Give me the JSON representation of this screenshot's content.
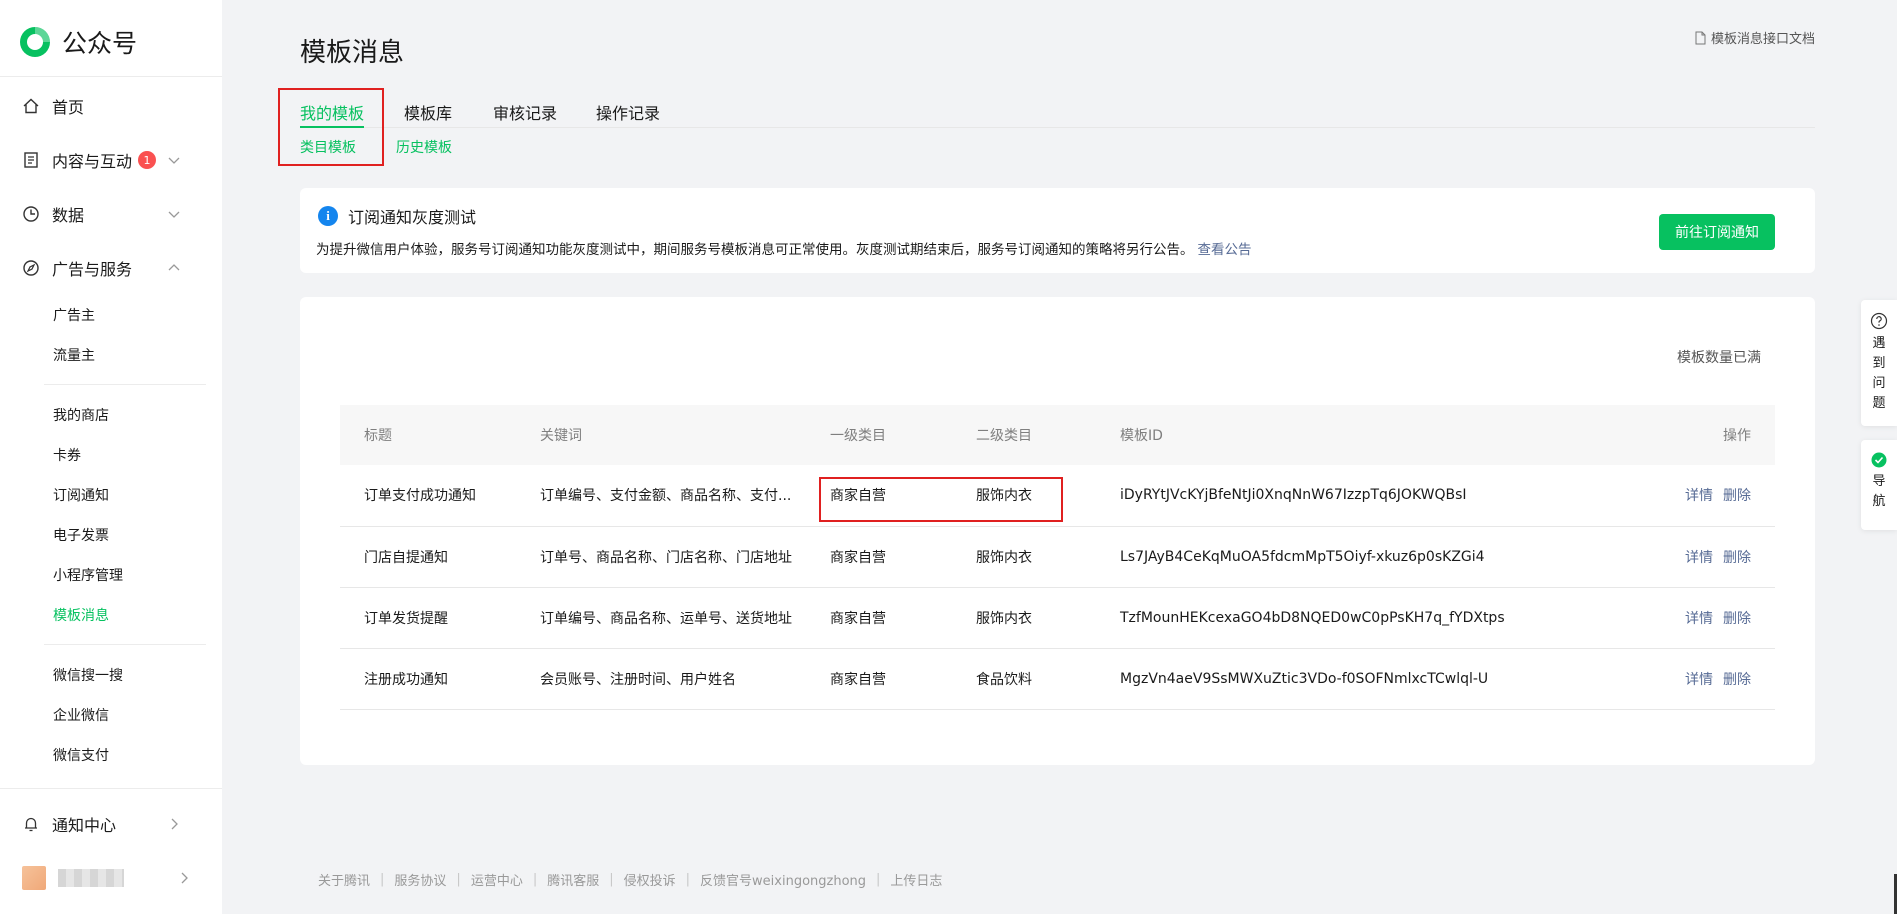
{
  "brand": {
    "name": "公众号",
    "accent": "#07c160"
  },
  "sidebar": {
    "items": [
      {
        "label": "首页",
        "icon": "home-icon"
      },
      {
        "label": "内容与互动",
        "icon": "document-icon",
        "badge": "1"
      },
      {
        "label": "数据",
        "icon": "clock-icon"
      },
      {
        "label": "广告与服务",
        "icon": "compass-icon"
      }
    ],
    "ads_sub": [
      "广告主",
      "流量主"
    ],
    "service_sub": [
      "我的商店",
      "卡券",
      "订阅通知",
      "电子发票",
      "小程序管理",
      "模板消息"
    ],
    "active_sub": "模板消息",
    "extra_sub": [
      "微信搜一搜",
      "企业微信",
      "微信支付"
    ],
    "notification": "通知中心"
  },
  "header": {
    "title": "模板消息",
    "doc_link": "模板消息接口文档"
  },
  "tabs": [
    {
      "label": "我的模板",
      "active": true
    },
    {
      "label": "模板库"
    },
    {
      "label": "审核记录"
    },
    {
      "label": "操作记录"
    }
  ],
  "subtabs": [
    {
      "label": "类目模板",
      "active": true
    },
    {
      "label": "历史模板"
    }
  ],
  "notice": {
    "title": "订阅通知灰度测试",
    "text": "为提升微信用户体验，服务号订阅通知功能灰度测试中，期间服务号模板消息可正常使用。灰度测试期结束后，服务号订阅通知的策略将另行公告。",
    "link": "查看公告",
    "button": "前往订阅通知"
  },
  "table": {
    "quota": "模板数量已满",
    "headers": [
      "标题",
      "关键词",
      "一级类目",
      "二级类目",
      "模板ID",
      "操作"
    ],
    "rows": [
      {
        "title": "订单支付成功通知",
        "keywords": "订单编号、支付金额、商品名称、支付...",
        "cat1": "商家自营",
        "cat2": "服饰内衣",
        "id": "iDyRYtJVcKYjBfeNtJi0XnqNnW67IzzpTq6JOKWQBsI"
      },
      {
        "title": "门店自提通知",
        "keywords": "订单号、商品名称、门店名称、门店地址",
        "cat1": "商家自营",
        "cat2": "服饰内衣",
        "id": "Ls7JAyB4CeKqMuOA5fdcmMpT5Oiyf-xkuz6p0sKZGi4"
      },
      {
        "title": "订单发货提醒",
        "keywords": "订单编号、商品名称、运单号、送货地址",
        "cat1": "商家自营",
        "cat2": "服饰内衣",
        "id": "TzfMounHEKcexaGO4bD8NQED0wC0pPsKH7q_fYDXtps"
      },
      {
        "title": "注册成功通知",
        "keywords": "会员账号、注册时间、用户姓名",
        "cat1": "商家自营",
        "cat2": "食品饮料",
        "id": "MgzVn4aeV9SsMWXuZtic3VDo-f0SOFNmlxcTCwlql-U"
      }
    ],
    "actions": {
      "detail": "详情",
      "delete": "删除"
    }
  },
  "footer": [
    "关于腾讯",
    "服务协议",
    "运营中心",
    "腾讯客服",
    "侵权投诉",
    "反馈官号weixingongzhong",
    "上传日志"
  ],
  "float": {
    "help": "遇到问题",
    "nav": "导航"
  }
}
